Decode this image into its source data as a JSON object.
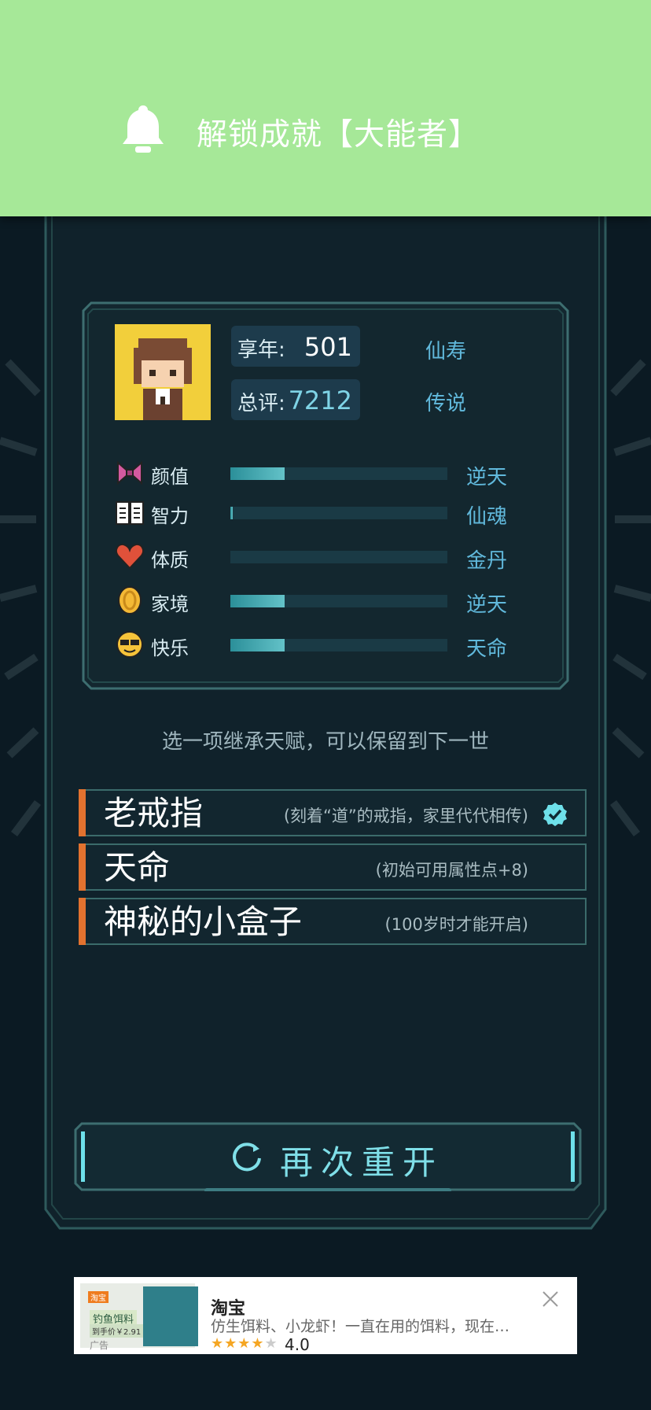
{
  "toast": {
    "icon": "bell-icon",
    "message": "解锁成就【大能者】"
  },
  "summary": {
    "age_label": "享年:",
    "age_value": "501",
    "age_rank": "仙寿",
    "score_label": "总评:",
    "score_value": "7212",
    "score_rank": "传说"
  },
  "attributes": [
    {
      "icon": "bow-icon",
      "name": "颜值",
      "grade": "逆天",
      "level": 0.25
    },
    {
      "icon": "book-icon",
      "name": "智力",
      "grade": "仙魂",
      "level": 0.01
    },
    {
      "icon": "heart-icon",
      "name": "体质",
      "grade": "金丹",
      "level": 0.0
    },
    {
      "icon": "coin-icon",
      "name": "家境",
      "grade": "逆天",
      "level": 0.25
    },
    {
      "icon": "sunglasses-icon",
      "name": "快乐",
      "grade": "天命",
      "level": 0.25
    }
  ],
  "inherit_hint": "选一项继承天赋，可以保留到下一世",
  "talents": [
    {
      "name": "老戒指",
      "desc": "(刻着“道”的戒指，家里代代相传)",
      "selected": true
    },
    {
      "name": "天命",
      "desc": "(初始可用属性点+8)",
      "selected": false
    },
    {
      "name": "神秘的小盒子",
      "desc": "(100岁时才能开启)",
      "selected": false
    }
  ],
  "restart_label": "再次重开",
  "ad": {
    "tag": "淘宝",
    "thumb_title": "钓鱼饵料",
    "thumb_price": "到手价￥2.91",
    "thumb_note": "广告",
    "brand": "淘宝",
    "desc": "仿生饵料、小龙虾！一直在用的饵料，现在…",
    "stars": 4,
    "rating": "4.0"
  },
  "colors": {
    "toast_bg": "#a6e898",
    "accent_orange": "#e2722f",
    "cyan": "#61b9dc",
    "page_bg": "#0b1a23"
  }
}
